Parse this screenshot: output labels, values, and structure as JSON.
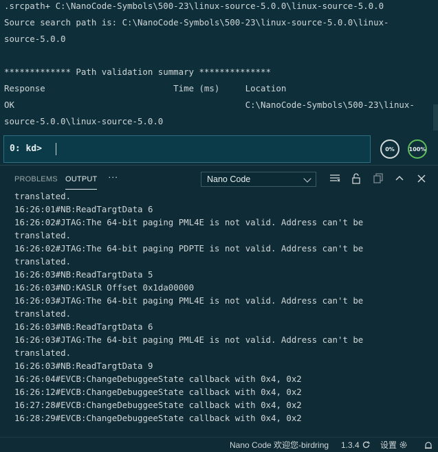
{
  "console": {
    "lines": [
      ".srcpath+ C:\\NanoCode-Symbols\\500-23\\linux-source-5.0.0\\linux-source-5.0.0",
      "Source search path is: C:\\NanoCode-Symbols\\500-23\\linux-source-5.0.0\\linux-",
      "source-5.0.0",
      "",
      "************* Path validation summary **************",
      "Response                         Time (ms)     Location",
      "OK                                             C:\\NanoCode-Symbols\\500-23\\linux-",
      "source-5.0.0\\linux-source-5.0.0"
    ]
  },
  "command": {
    "prompt": "0: kd>",
    "value": ""
  },
  "gauges": {
    "cpu_label": "0%",
    "mem_label": "100%"
  },
  "panel": {
    "tabs": [
      "PROBLEMS",
      "OUTPUT"
    ],
    "active_tab": "OUTPUT",
    "more_label": "···",
    "channel": "Nano Code",
    "icons": [
      "list-filter-icon",
      "lock-icon",
      "copy-icon",
      "chevron-up-icon",
      "close-icon"
    ]
  },
  "output": {
    "lines": [
      "translated.",
      "16:26:01#NB:ReadTargtData 6",
      "16:26:02#JTAG:The 64-bit paging PML4E is not valid. Address can't be",
      "translated.",
      "16:26:02#JTAG:The 64-bit paging PDPTE is not valid. Address can't be",
      "translated.",
      "16:26:03#NB:ReadTargtData 5",
      "16:26:03#ND:KASLR Offset 0x1da00000",
      "16:26:03#JTAG:The 64-bit paging PML4E is not valid. Address can't be",
      "translated.",
      "16:26:03#NB:ReadTargtData 6",
      "16:26:03#JTAG:The 64-bit paging PML4E is not valid. Address can't be",
      "translated.",
      "16:26:03#NB:ReadTargtData 9",
      "16:26:04#EVCB:ChangeDebuggeeState callback with 0x4, 0x2",
      "16:26:12#EVCB:ChangeDebuggeeState callback with 0x4, 0x2",
      "16:27:28#EVCB:ChangeDebuggeeState callback with 0x4, 0x2",
      "16:28:29#EVCB:ChangeDebuggeeState callback with 0x4, 0x2"
    ]
  },
  "statusbar": {
    "extension": "Nano Code 欢迎您-birdring",
    "version": "1.3.4",
    "settings": "设置"
  }
}
